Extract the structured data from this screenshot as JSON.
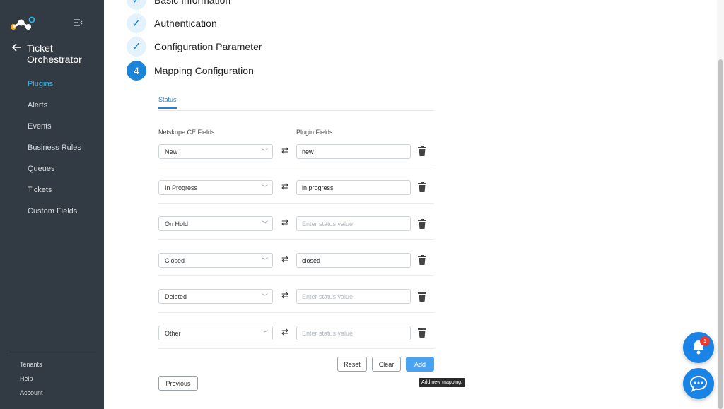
{
  "sidebar": {
    "app_title": "Ticket Orchestrator",
    "nav": [
      {
        "label": "Plugins",
        "active": true
      },
      {
        "label": "Alerts"
      },
      {
        "label": "Events"
      },
      {
        "label": "Business Rules"
      },
      {
        "label": "Queues"
      },
      {
        "label": "Tickets"
      },
      {
        "label": "Custom Fields"
      }
    ],
    "bottom": [
      "Tenants",
      "Help",
      "Account"
    ]
  },
  "steps": [
    {
      "label": "Basic Information",
      "state": "done"
    },
    {
      "label": "Authentication",
      "state": "done"
    },
    {
      "label": "Configuration Parameter",
      "state": "done"
    },
    {
      "label": "Mapping Configuration",
      "state": "active",
      "number": "4"
    }
  ],
  "tab": "Status",
  "columns": {
    "left": "Netskope CE Fields",
    "right": "Plugin Fields"
  },
  "mappings": [
    {
      "ce_field": "New",
      "plugin_value": "new",
      "placeholder": "Enter status value"
    },
    {
      "ce_field": "In Progress",
      "plugin_value": "in progress",
      "placeholder": "Enter status value"
    },
    {
      "ce_field": "On Hold",
      "plugin_value": "",
      "placeholder": "Enter status value"
    },
    {
      "ce_field": "Closed",
      "plugin_value": "closed",
      "placeholder": "Enter status value"
    },
    {
      "ce_field": "Deleted",
      "plugin_value": "",
      "placeholder": "Enter status value"
    },
    {
      "ce_field": "Other",
      "plugin_value": "",
      "placeholder": "Enter status value"
    }
  ],
  "buttons": {
    "reset": "Reset",
    "clear": "Clear",
    "add": "Add",
    "previous": "Previous"
  },
  "tooltip": "Add new mapping.",
  "notifications": {
    "count": "1"
  },
  "colors": {
    "accent": "#1b84d8",
    "sidebar": "#323b43",
    "active_nav": "#2fb6e8",
    "badge": "#e53935"
  }
}
